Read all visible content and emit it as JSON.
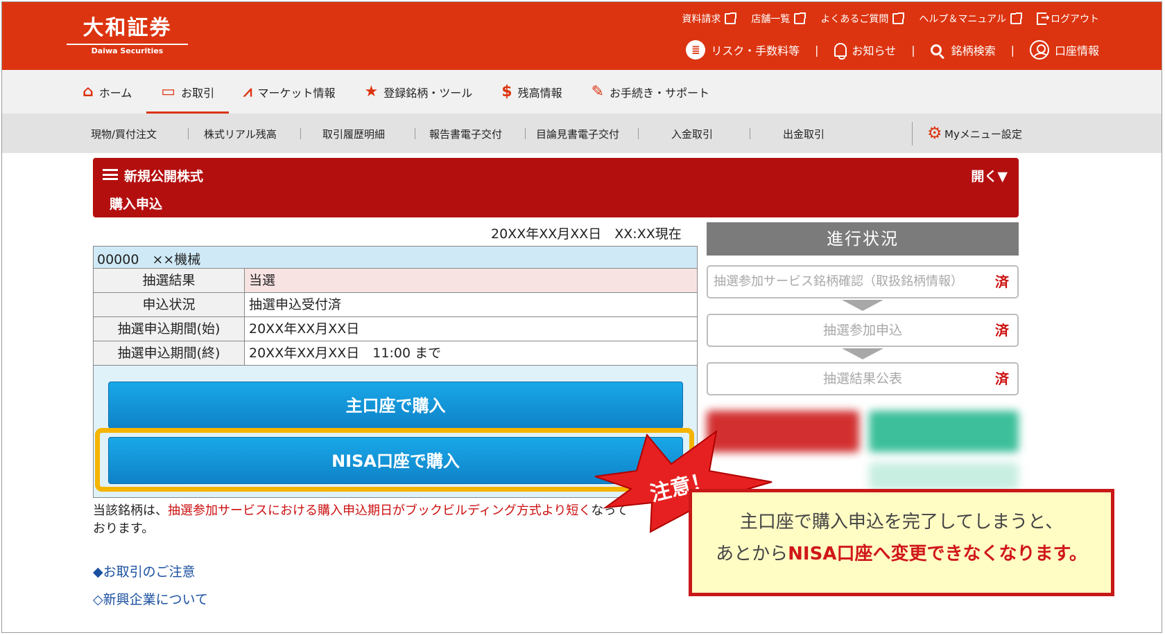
{
  "header": {
    "logo_main": "大和証券",
    "logo_sub": "Daiwa Securities",
    "top_links": [
      "資料請求",
      "店舗一覧",
      "よくあるご質問",
      "ヘルプ＆マニュアル"
    ],
    "logout": "ログアウト",
    "sub_links": {
      "risk": "リスク・手数料等",
      "notice": "お知らせ",
      "search": "銘柄検索",
      "account": "口座情報"
    }
  },
  "main_nav": [
    "ホーム",
    "お取引",
    "マーケット情報",
    "登録銘柄・ツール",
    "残高情報",
    "お手続き・サポート"
  ],
  "sub_nav": [
    "現物/買付注文",
    "株式リアル残高",
    "取引履歴明細",
    "報告書電子交付",
    "目論見書電子交付",
    "入金取引",
    "出金取引"
  ],
  "my_menu": "Myメニュー設定",
  "band": {
    "title": "新規公開株式",
    "subtitle": "購入申込",
    "toggle": "開く▼"
  },
  "as_of": "20XX年XX月XX日　XX:XX現在",
  "stock": {
    "title": "00000　××機械",
    "rows": [
      {
        "key": "抽選結果",
        "value": "当選"
      },
      {
        "key": "申込状況",
        "value": "抽選申込受付済"
      },
      {
        "key": "抽選申込期間(始)",
        "value": "20XX年XX月XX日"
      },
      {
        "key": "抽選申込期間(終)",
        "value": "20XX年XX月XX日　11:00 まで"
      }
    ],
    "btn_main": "主口座で購入",
    "btn_nisa": "NISA口座で購入"
  },
  "note": {
    "prefix": "当該銘柄は、",
    "red": "抽選参加サービスにおける購入申込期日がブックビルディング方式より短く",
    "suffix": "なって",
    "line2": "おります。"
  },
  "links": [
    "◆お取引のご注意",
    "◇新興企業について"
  ],
  "progress": {
    "title": "進行状況",
    "steps": [
      {
        "label": "抽選参加サービス銘柄確認（取扱銘柄情報）",
        "status": "済"
      },
      {
        "label": "抽選参加申込",
        "status": "済"
      },
      {
        "label": "抽選結果公表",
        "status": "済"
      }
    ]
  },
  "callout": {
    "burst": "注意！",
    "line1": "主口座で購入申込を完了してしまうと、",
    "line2_prefix": "あとから",
    "line2_bold": "NISA口座へ変更できなくなります。"
  },
  "colors": {
    "header_red": "#dc3410",
    "band_red": "#b40f0f",
    "button_blue": "#0f82c8",
    "highlight": "#f5b400"
  }
}
